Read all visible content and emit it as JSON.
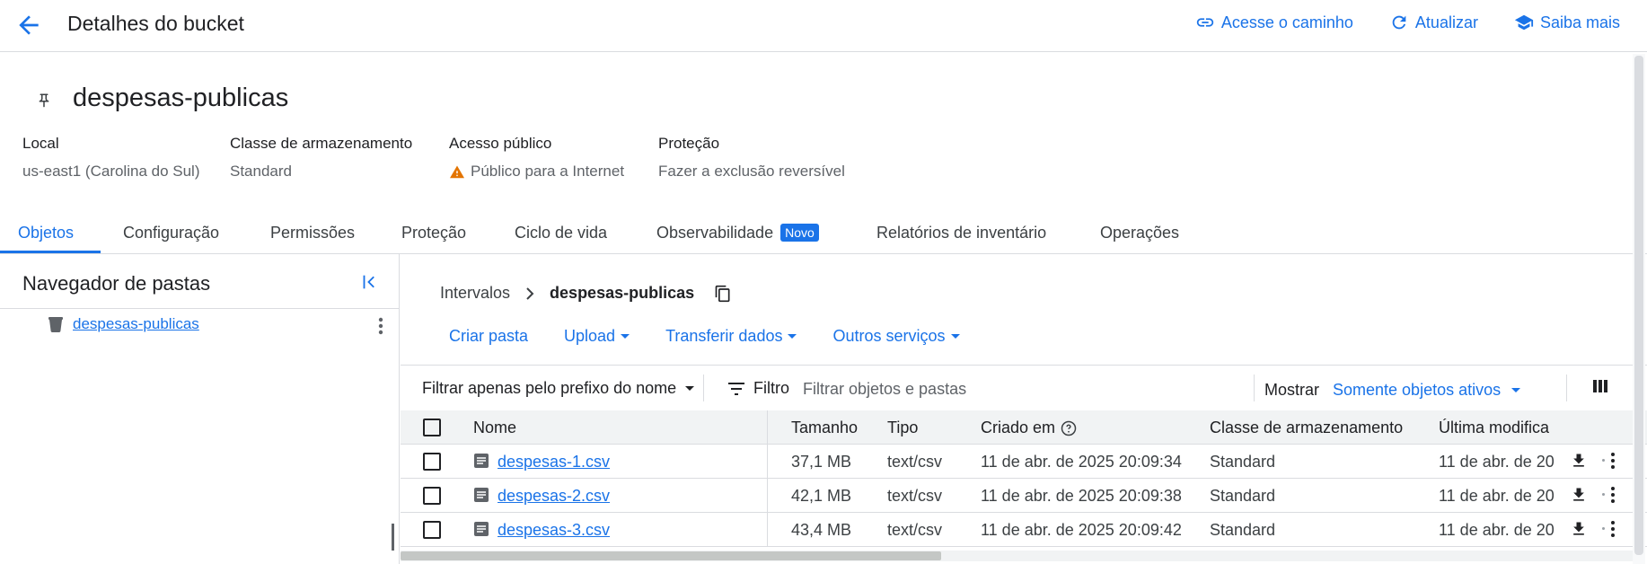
{
  "header": {
    "title": "Detalhes do bucket",
    "actions": [
      {
        "label": "Acesse o caminho",
        "icon": "link-icon"
      },
      {
        "label": "Atualizar",
        "icon": "refresh-icon"
      },
      {
        "label": "Saiba mais",
        "icon": "school-icon"
      }
    ]
  },
  "bucket": {
    "name": "despesas-publicas",
    "meta": [
      {
        "label": "Local",
        "value": "us-east1 (Carolina do Sul)"
      },
      {
        "label": "Classe de armazenamento",
        "value": "Standard"
      },
      {
        "label": "Acesso público",
        "value": "Público para a Internet",
        "icon": "warning-icon"
      },
      {
        "label": "Proteção",
        "value": "Fazer a exclusão reversível"
      }
    ]
  },
  "tabs": [
    {
      "label": "Objetos",
      "active": true
    },
    {
      "label": "Configuração"
    },
    {
      "label": "Permissões"
    },
    {
      "label": "Proteção"
    },
    {
      "label": "Ciclo de vida"
    },
    {
      "label": "Observabilidade",
      "badge": "Novo"
    },
    {
      "label": "Relatórios de inventário"
    },
    {
      "label": "Operações"
    }
  ],
  "folder_panel": {
    "title": "Navegador de pastas",
    "item": "despesas-publicas"
  },
  "breadcrumb": {
    "root": "Intervalos",
    "current": "despesas-publicas"
  },
  "actions": [
    "Criar pasta",
    "Upload",
    "Transferir dados",
    "Outros serviços"
  ],
  "filter": {
    "prefix_label": "Filtrar apenas pelo prefixo do nome",
    "filter_label": "Filtro",
    "placeholder": "Filtrar objetos e pastas",
    "show_label": "Mostrar",
    "show_value": "Somente objetos ativos"
  },
  "table": {
    "headers": {
      "name": "Nome",
      "size": "Tamanho",
      "type": "Tipo",
      "created": "Criado em",
      "storage_class": "Classe de armazenamento",
      "modified": "Última modifica"
    },
    "rows": [
      {
        "name": "despesas-1.csv",
        "size": "37,1 MB",
        "type": "text/csv",
        "created": "11 de abr. de 2025 20:09:34",
        "storage_class": "Standard",
        "modified": "11 de abr. de 20"
      },
      {
        "name": "despesas-2.csv",
        "size": "42,1 MB",
        "type": "text/csv",
        "created": "11 de abr. de 2025 20:09:38",
        "storage_class": "Standard",
        "modified": "11 de abr. de 20"
      },
      {
        "name": "despesas-3.csv",
        "size": "43,4 MB",
        "type": "text/csv",
        "created": "11 de abr. de 2025 20:09:42",
        "storage_class": "Standard",
        "modified": "11 de abr. de 20"
      }
    ]
  },
  "colors": {
    "accent": "#1a73e8",
    "warning": "#e37400",
    "border": "#dadce0"
  }
}
